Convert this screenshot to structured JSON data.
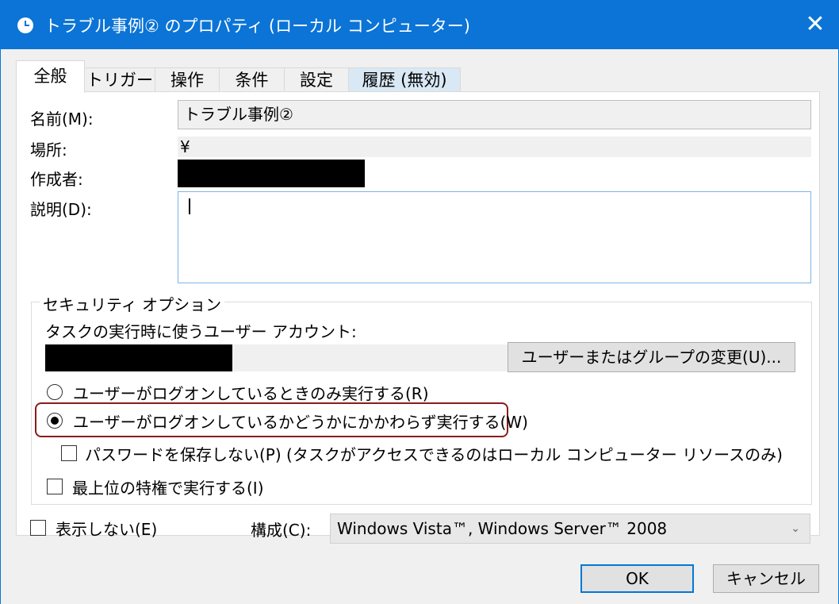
{
  "window": {
    "title": "トラブル事例② のプロパティ (ローカル コンピューター)",
    "close_glyph": "✕"
  },
  "tabs": [
    {
      "label": "全般",
      "state": "active"
    },
    {
      "label": "トリガー",
      "state": "normal"
    },
    {
      "label": "操作",
      "state": "normal"
    },
    {
      "label": "条件",
      "state": "normal"
    },
    {
      "label": "設定",
      "state": "normal"
    },
    {
      "label": "履歴 (無効)",
      "state": "disabled"
    }
  ],
  "general": {
    "name_label": "名前(M):",
    "name_value": "トラブル事例②",
    "location_label": "場所:",
    "location_value": "¥",
    "author_label": "作成者:",
    "description_label": "説明(D):",
    "description_value": ""
  },
  "security": {
    "legend": "セキュリティ オプション",
    "account_label": "タスクの実行時に使うユーザー アカウント:",
    "change_button": "ユーザーまたはグループの変更(U)...",
    "radio_logged_on_only": "ユーザーがログオンしているときのみ実行する(R)",
    "radio_whether_logged_on": "ユーザーがログオンしているかどうかにかかわらず実行する(W)",
    "selected_option": "radio_whether_logged_on",
    "no_store_password": "パスワードを保存しない(P) (タスクがアクセスできるのはローカル コンピューター リソースのみ)",
    "no_store_password_checked": false,
    "highest_privileges": "最上位の特権で実行する(I)",
    "highest_privileges_checked": false
  },
  "footer": {
    "hidden_label": "表示しない(E)",
    "hidden_checked": false,
    "configure_label": "構成(C):",
    "configure_value": "Windows Vista™, Windows Server™ 2008",
    "ok": "OK",
    "cancel": "キャンセル"
  },
  "colors": {
    "titlebar": "#0b74d6",
    "highlight_border": "#8b1c1c",
    "focus_border": "#7eb4ea"
  }
}
